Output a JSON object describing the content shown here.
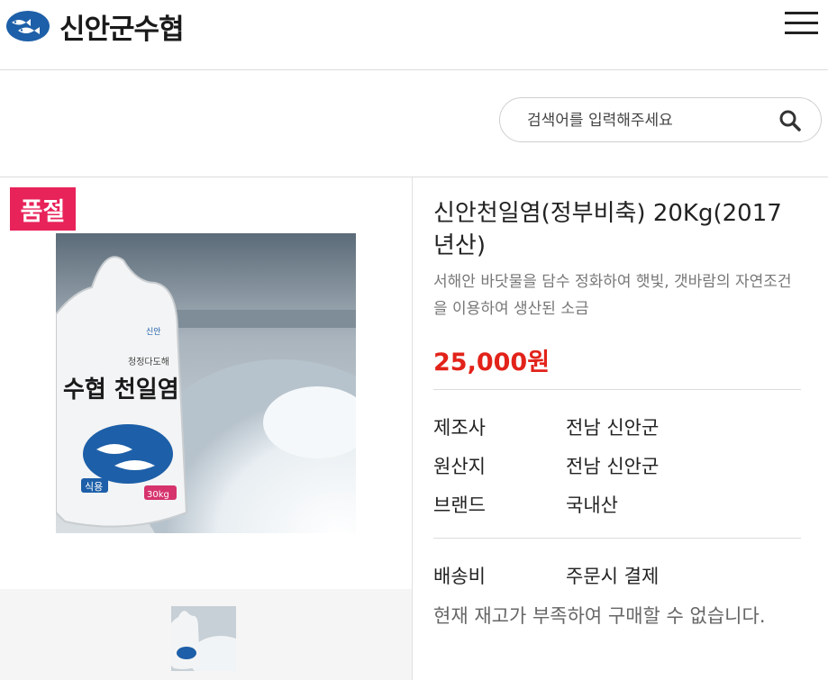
{
  "header": {
    "logo_text": "신안군수협",
    "menu_icon": "hamburger-menu-icon"
  },
  "search": {
    "placeholder": "검색어를 입력해주세요",
    "icon": "search-icon"
  },
  "product": {
    "badge": "품절",
    "title": "신안천일염(정부비축) 20Kg(2017년산)",
    "description": "서해안 바닷물을 담수 정화하여 햇빛, 갯바람의 자연조건을 이용하여 생산된 소금",
    "price": "25,000원",
    "specs": [
      {
        "label": "제조사",
        "value": "전남 신안군"
      },
      {
        "label": "원산지",
        "value": "전남 신안군"
      },
      {
        "label": "브랜드",
        "value": "국내산"
      }
    ],
    "shipping": {
      "label": "배송비",
      "value": "주문시 결제"
    },
    "stock_notice": "현재 재고가 부족하여 구매할 수 없습니다."
  },
  "image_labels": {
    "bag_text": "수협 천일염",
    "bag_small_1": "신안",
    "bag_small_2": "청정다도해",
    "bag_type": "식용",
    "bag_weight": "30kg"
  },
  "colors": {
    "accent_price": "#e2231a",
    "badge_bg": "#e8235a",
    "logo_blue": "#1d5fa8"
  }
}
